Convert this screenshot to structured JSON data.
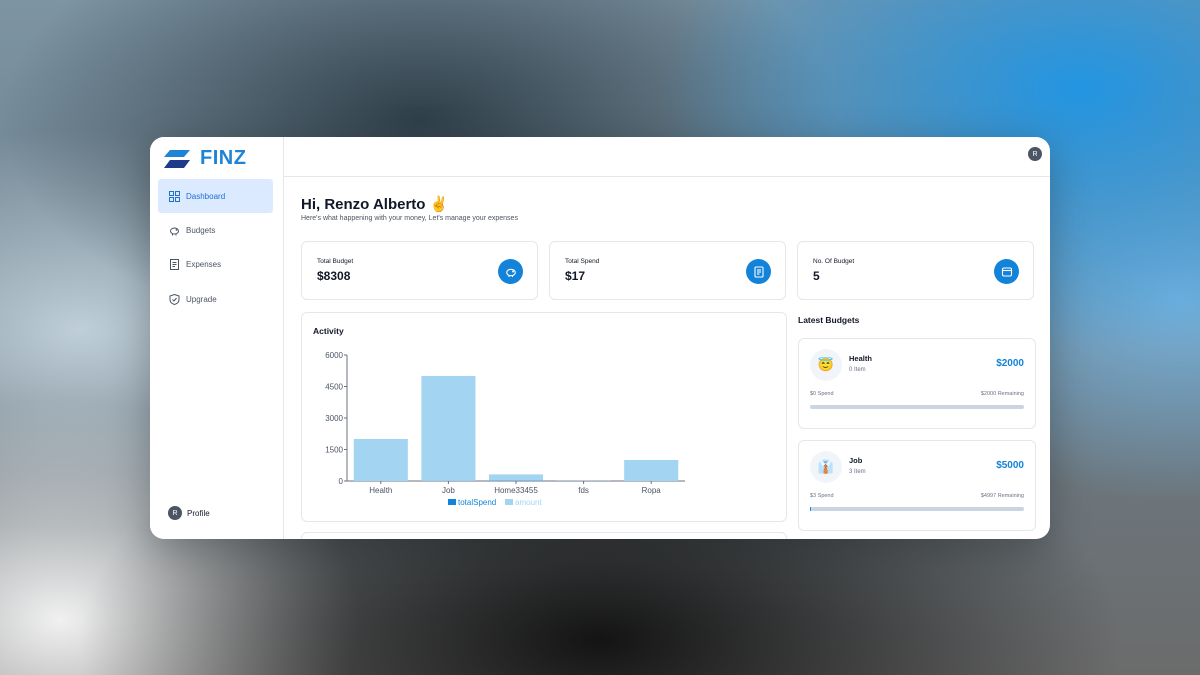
{
  "brand": {
    "name": "FINZ"
  },
  "sidebar": {
    "items": [
      {
        "label": "Dashboard",
        "icon": "dashboard-grid-icon",
        "active": true
      },
      {
        "label": "Budgets",
        "icon": "piggy-bank-icon",
        "active": false
      },
      {
        "label": "Expenses",
        "icon": "receipt-icon",
        "active": false
      },
      {
        "label": "Upgrade",
        "icon": "shield-check-icon",
        "active": false
      }
    ],
    "profile": {
      "initial": "R",
      "label": "Profile"
    }
  },
  "topbar": {
    "avatar_initial": "R"
  },
  "main": {
    "greeting": "Hi, Renzo Alberto ✌️",
    "subtitle": "Here's what happening with your money, Let's manage your expenses"
  },
  "stats": [
    {
      "label": "Total Budget",
      "value": "$8308",
      "icon": "piggy-bank-icon"
    },
    {
      "label": "Total Spend",
      "value": "$17",
      "icon": "receipt-icon"
    },
    {
      "label": "No. Of Budget",
      "value": "5",
      "icon": "wallet-icon"
    }
  ],
  "activity": {
    "title": "Activity"
  },
  "chart_data": {
    "type": "bar",
    "title": "Activity",
    "categories": [
      "Health",
      "Job",
      "Home33455",
      "fds",
      "Ropa"
    ],
    "series": [
      {
        "name": "totalSpend",
        "values": [
          0,
          3,
          14,
          0,
          0
        ],
        "color": "#1283d8"
      },
      {
        "name": "amount",
        "values": [
          2000,
          5000,
          300,
          8,
          1000
        ],
        "color": "#a3d4f2"
      }
    ],
    "yticks": [
      0,
      1500,
      3000,
      4500,
      6000
    ],
    "ylim": [
      0,
      6000
    ],
    "stacked": true,
    "legend": "bottom"
  },
  "latest": {
    "title": "Latest Budgets",
    "budgets": [
      {
        "emoji": "😇",
        "name": "Health",
        "items": "0 Item",
        "amount": "$2000",
        "spend": "$0 Spend",
        "remaining": "$2000 Remaining",
        "progress": 0
      },
      {
        "emoji": "👔",
        "name": "Job",
        "items": "3 Item",
        "amount": "$5000",
        "spend": "$3 Spend",
        "remaining": "$4997 Remaining",
        "progress": 0.0006
      }
    ]
  },
  "colors": {
    "accent": "#1283d8",
    "active_nav_bg": "#dbeafe",
    "bar_light": "#a3d4f2"
  }
}
